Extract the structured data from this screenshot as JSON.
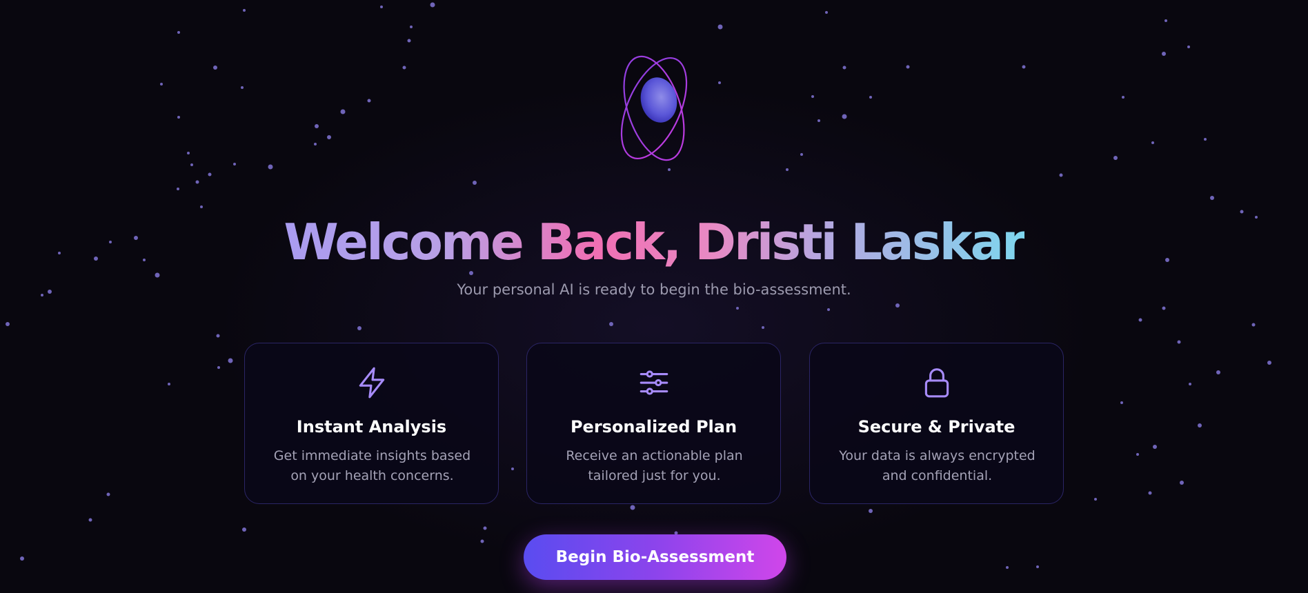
{
  "hero": {
    "headline": "Welcome Back, Dristi Laskar",
    "subtitle": "Your personal AI is ready to begin the bio-assessment."
  },
  "features": [
    {
      "icon": "lightning-icon",
      "title": "Instant Analysis",
      "description": "Get immediate insights based on your health concerns."
    },
    {
      "icon": "sliders-icon",
      "title": "Personalized Plan",
      "description": "Receive an actionable plan tailored just for you."
    },
    {
      "icon": "lock-icon",
      "title": "Secure & Private",
      "description": "Your data is always encrypted and confidential."
    }
  ],
  "cta": {
    "label": "Begin Bio-Assessment"
  },
  "colors": {
    "background": "#09070f",
    "accent_purple": "#8b5cf6",
    "accent_pink": "#f06fb3",
    "accent_cyan": "#7ed6ee",
    "card_border": "#2b2566"
  }
}
